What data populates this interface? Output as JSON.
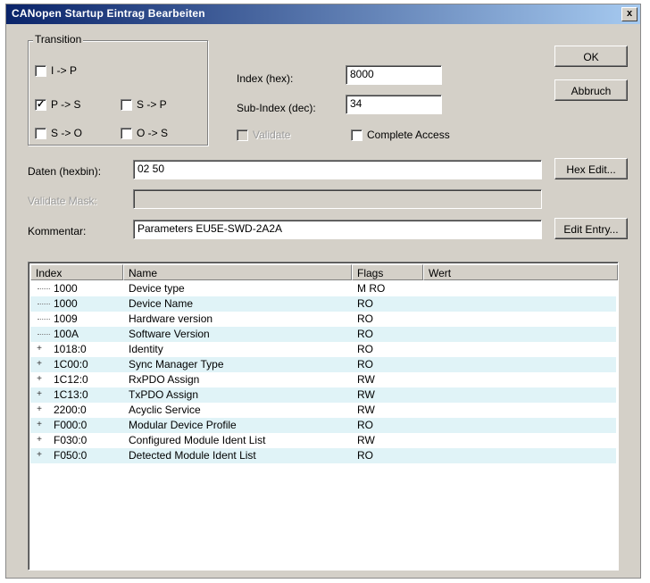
{
  "window": {
    "title": "CANopen Startup Eintrag Bearbeiten",
    "close_glyph": "x"
  },
  "transition": {
    "label": "Transition",
    "items": [
      {
        "label": "I -> P",
        "checked": false
      },
      {
        "label": "P -> S",
        "checked": true
      },
      {
        "label": "S -> P",
        "checked": false
      },
      {
        "label": "S -> O",
        "checked": false
      },
      {
        "label": "O -> S",
        "checked": false
      }
    ]
  },
  "index": {
    "label": "Index (hex):",
    "value": "8000"
  },
  "subindex": {
    "label": "Sub-Index (dec):",
    "value": "34"
  },
  "validate": {
    "label": "Validate",
    "checked": false,
    "enabled": false
  },
  "complete_access": {
    "label": "Complete Access",
    "checked": false
  },
  "daten": {
    "label": "Daten (hexbin):",
    "value": "02 50"
  },
  "validate_mask": {
    "label": "Validate Mask:",
    "value": ""
  },
  "kommentar": {
    "label": "Kommentar:",
    "value": "Parameters EU5E-SWD-2A2A"
  },
  "buttons": {
    "ok": "OK",
    "abbruch": "Abbruch",
    "hex_edit": "Hex Edit...",
    "edit_entry": "Edit Entry..."
  },
  "table": {
    "columns": [
      "Index",
      "Name",
      "Flags",
      "Wert"
    ],
    "rows": [
      {
        "index": "1000",
        "name": "Device type",
        "flags": "M RO",
        "wert": "",
        "expandable": false
      },
      {
        "index": "1000",
        "name": "Device Name",
        "flags": "RO",
        "wert": "",
        "expandable": false
      },
      {
        "index": "1009",
        "name": "Hardware version",
        "flags": "RO",
        "wert": "",
        "expandable": false
      },
      {
        "index": "100A",
        "name": "Software Version",
        "flags": "RO",
        "wert": "",
        "expandable": false
      },
      {
        "index": "1018:0",
        "name": "Identity",
        "flags": "RO",
        "wert": "",
        "expandable": true
      },
      {
        "index": "1C00:0",
        "name": "Sync Manager Type",
        "flags": "RO",
        "wert": "",
        "expandable": true
      },
      {
        "index": "1C12:0",
        "name": "RxPDO Assign",
        "flags": "RW",
        "wert": "",
        "expandable": true
      },
      {
        "index": "1C13:0",
        "name": "TxPDO Assign",
        "flags": "RW",
        "wert": "",
        "expandable": true
      },
      {
        "index": "2200:0",
        "name": "Acyclic Service",
        "flags": "RW",
        "wert": "",
        "expandable": true
      },
      {
        "index": "F000:0",
        "name": "Modular Device Profile",
        "flags": "RO",
        "wert": "",
        "expandable": true
      },
      {
        "index": "F030:0",
        "name": "Configured Module Ident List",
        "flags": "RW",
        "wert": "",
        "expandable": true
      },
      {
        "index": "F050:0",
        "name": "Detected Module Ident List",
        "flags": "RO",
        "wert": "",
        "expandable": true
      }
    ]
  }
}
